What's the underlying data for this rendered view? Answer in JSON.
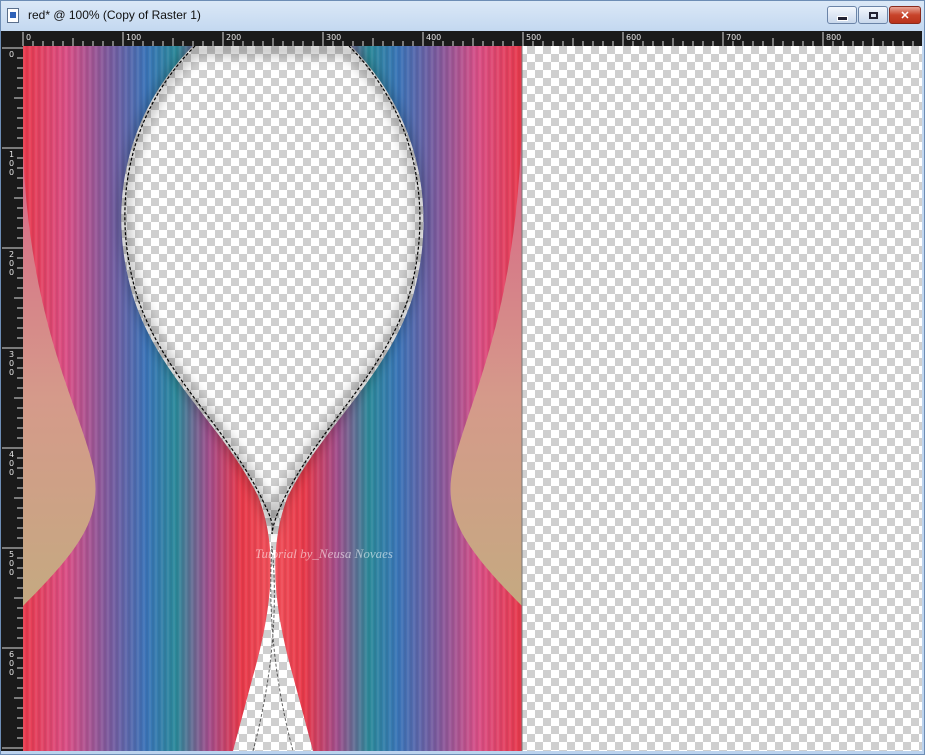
{
  "window": {
    "title": "red* @ 100% (Copy of Raster 1)",
    "controls": {
      "minimize_icon": "minimize-icon",
      "maximize_icon": "maximize-icon",
      "close_icon": "close-icon"
    }
  },
  "ruler_top": {
    "labels": [
      "0",
      "100",
      "200",
      "300",
      "400",
      "500",
      "600",
      "700",
      "800"
    ]
  },
  "ruler_left": {
    "labels": [
      "0",
      "100",
      "200",
      "300",
      "400",
      "500",
      "600"
    ]
  },
  "canvas": {
    "watermark": "Tutorial by_Neusa Novaes",
    "colors": {
      "red": "#e8394a",
      "pink": "#d94f86",
      "blue": "#3b74b8",
      "teal": "#2c8a9a",
      "purple": "#7b5b9e",
      "orange": "#e2643a",
      "olive": "#b9b47a"
    }
  }
}
